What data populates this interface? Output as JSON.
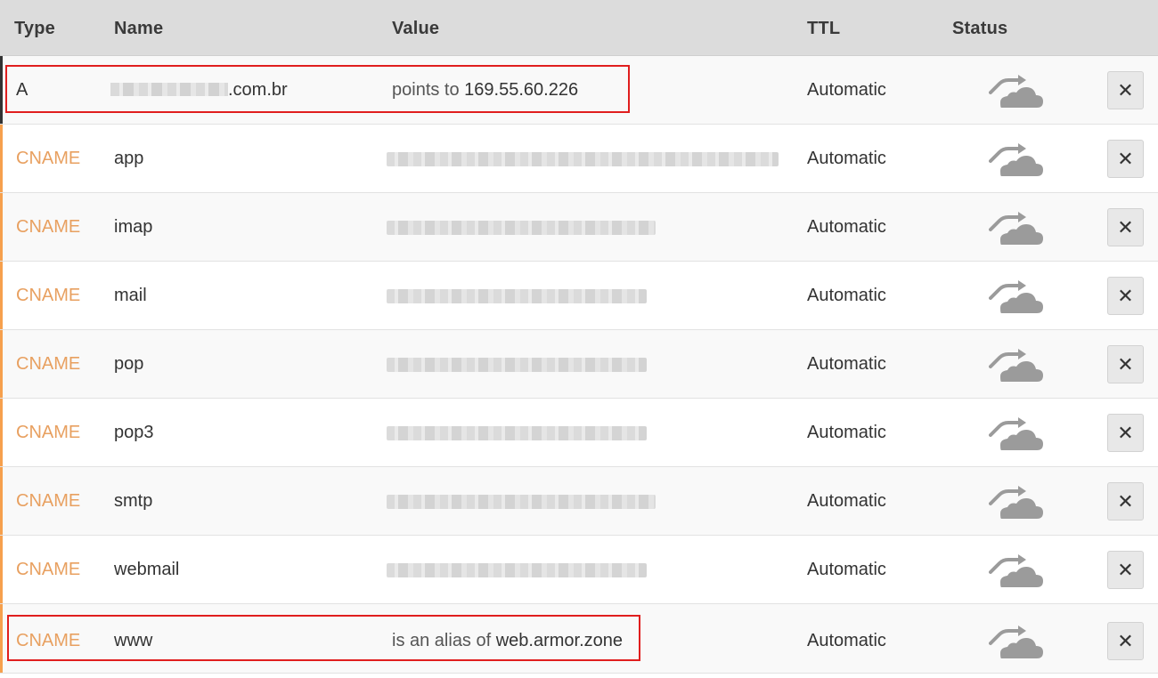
{
  "columns": {
    "type": "Type",
    "name": "Name",
    "value": "Value",
    "ttl": "TTL",
    "status": "Status"
  },
  "colors": {
    "a_accent": "#333333",
    "cname_accent": "#f6a04d",
    "cname_text": "#e8a060",
    "highlight": "#e01e1e"
  },
  "rows": [
    {
      "type": "A",
      "name_suffix": ".com.br",
      "name_redacted": true,
      "value_prefix": "points to ",
      "value_main": "169.55.60.226",
      "value_redacted": false,
      "ttl": "Automatic",
      "status_icon": "cloud-proxied-icon",
      "delete_icon": "close-icon"
    },
    {
      "type": "CNAME",
      "name": "app",
      "value_redacted": true,
      "ttl": "Automatic",
      "status_icon": "cloud-proxied-icon",
      "delete_icon": "close-icon"
    },
    {
      "type": "CNAME",
      "name": "imap",
      "value_redacted": true,
      "ttl": "Automatic",
      "status_icon": "cloud-proxied-icon",
      "delete_icon": "close-icon"
    },
    {
      "type": "CNAME",
      "name": "mail",
      "value_redacted": true,
      "ttl": "Automatic",
      "status_icon": "cloud-proxied-icon",
      "delete_icon": "close-icon"
    },
    {
      "type": "CNAME",
      "name": "pop",
      "value_redacted": true,
      "ttl": "Automatic",
      "status_icon": "cloud-proxied-icon",
      "delete_icon": "close-icon"
    },
    {
      "type": "CNAME",
      "name": "pop3",
      "value_redacted": true,
      "ttl": "Automatic",
      "status_icon": "cloud-proxied-icon",
      "delete_icon": "close-icon"
    },
    {
      "type": "CNAME",
      "name": "smtp",
      "value_redacted": true,
      "ttl": "Automatic",
      "status_icon": "cloud-proxied-icon",
      "delete_icon": "close-icon"
    },
    {
      "type": "CNAME",
      "name": "webmail",
      "value_redacted": true,
      "ttl": "Automatic",
      "status_icon": "cloud-proxied-icon",
      "delete_icon": "close-icon"
    },
    {
      "type": "CNAME",
      "name": "www",
      "value_prefix": "is an alias of ",
      "value_main": "web.armor.zone",
      "value_redacted": false,
      "ttl": "Automatic",
      "status_icon": "cloud-proxied-icon",
      "delete_icon": "close-icon"
    }
  ],
  "delete_glyph": "✕"
}
